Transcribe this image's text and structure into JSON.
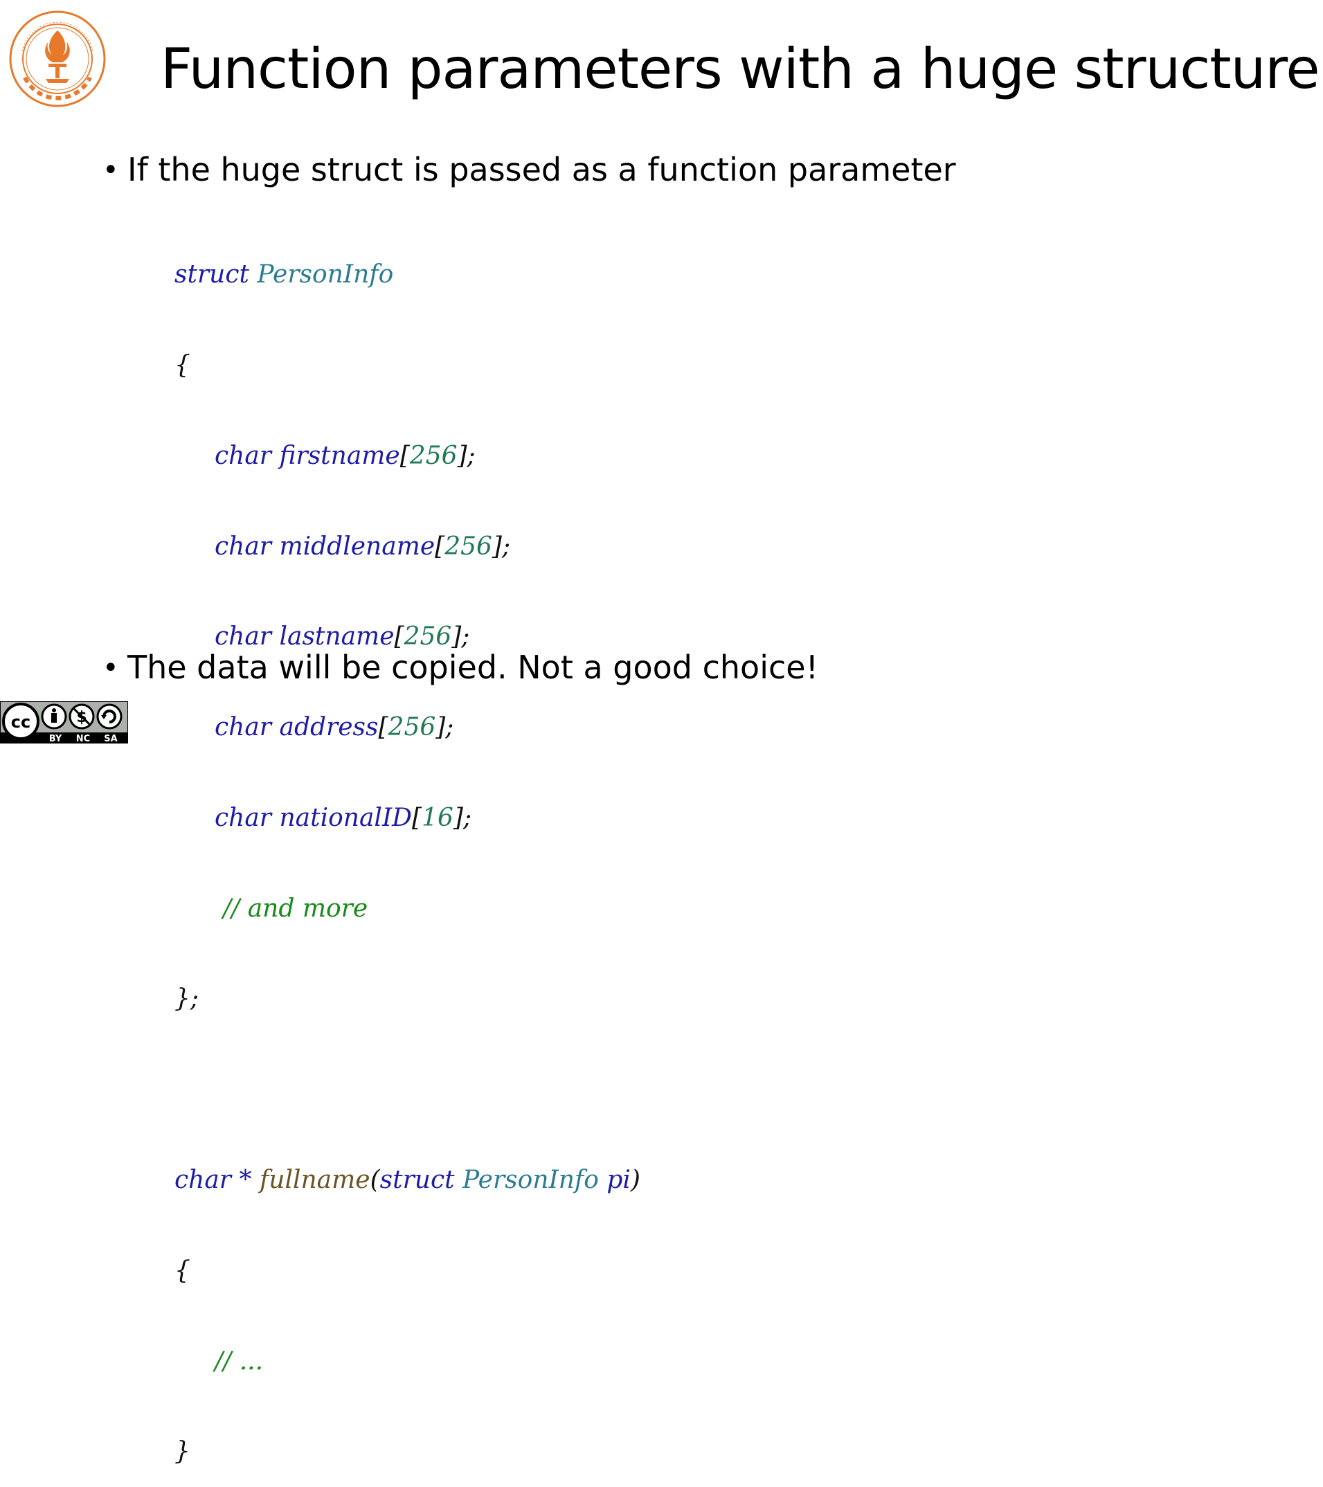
{
  "slide": {
    "title": "Function parameters with a huge structure",
    "bullets": [
      "If the huge struct is passed as a function parameter",
      "The data will be copied. Not a good choice!"
    ],
    "bullet_glyph": "•"
  },
  "code": {
    "struct_kw": "struct",
    "struct_name": "PersonInfo",
    "open_brace": "{",
    "close_struct": "};",
    "fields": [
      {
        "type": "char",
        "name": "firstname",
        "size": "256"
      },
      {
        "type": "char",
        "name": "middlename",
        "size": "256"
      },
      {
        "type": "char",
        "name": "lastname",
        "size": "256"
      },
      {
        "type": "char",
        "name": "address",
        "size": "256"
      },
      {
        "type": "char",
        "name": "nationalID",
        "size": "16"
      }
    ],
    "lbracket": "[",
    "rbracket_semi": "];",
    "comment_more": "// and more",
    "func_ret": "char",
    "func_star": "*",
    "func_name": "fullname",
    "lparen": "(",
    "param_kw": "struct",
    "param_type": "PersonInfo",
    "param_name": "pi",
    "rparen": ")",
    "func_open": "{",
    "func_comment": "// ...",
    "func_close": "}"
  },
  "badges": {
    "cc_labels": [
      "BY",
      "NC",
      "SA"
    ],
    "cc_mark": "cc",
    "logo_icon": "sustech-seal-icon"
  },
  "colors": {
    "keyword": "#1c1ca8",
    "type": "#2b7c93",
    "number": "#1f7a54",
    "comment": "#1a8a1a",
    "function": "#6b5422",
    "logo": "#e8792a"
  }
}
